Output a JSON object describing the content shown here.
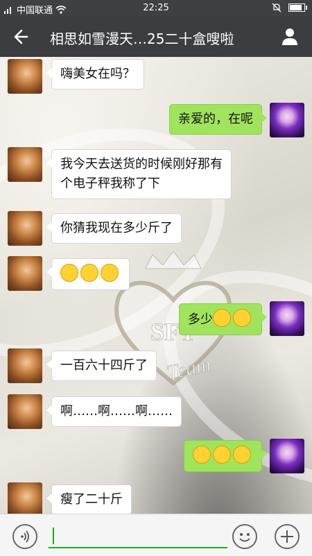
{
  "status": {
    "carrier": "中国联通",
    "time": "22:25",
    "battery_level": 0.85
  },
  "header": {
    "title": "相思如雪漫天…25二十盒嗖啦"
  },
  "messages": [
    {
      "side": "in",
      "text": "嗨美女在吗？"
    },
    {
      "side": "out",
      "text": "亲爱的，在呢"
    },
    {
      "side": "in",
      "line1": "我今天去送货的时候刚好那有",
      "line2": "个电子秤我称了下"
    },
    {
      "side": "in",
      "text": "你猜我现在多少斤了"
    },
    {
      "side": "in",
      "emoji": "grin-emoji-x3"
    },
    {
      "side": "out",
      "text": "多少",
      "emoji": "astonished-emoji-x2"
    },
    {
      "side": "in",
      "text": "一百六十四斤了"
    },
    {
      "side": "in",
      "text": "啊……啊……啊……"
    },
    {
      "side": "out",
      "emoji": "scream-emoji-x3"
    },
    {
      "side": "in",
      "text": "瘦了二十斤"
    }
  ],
  "watermark": {
    "logo": "SFT",
    "word": "Team"
  },
  "colors": {
    "titlebar": "#3b3d41",
    "outgoing_bubble": "#9fe45c",
    "accent": "#1aad19"
  }
}
